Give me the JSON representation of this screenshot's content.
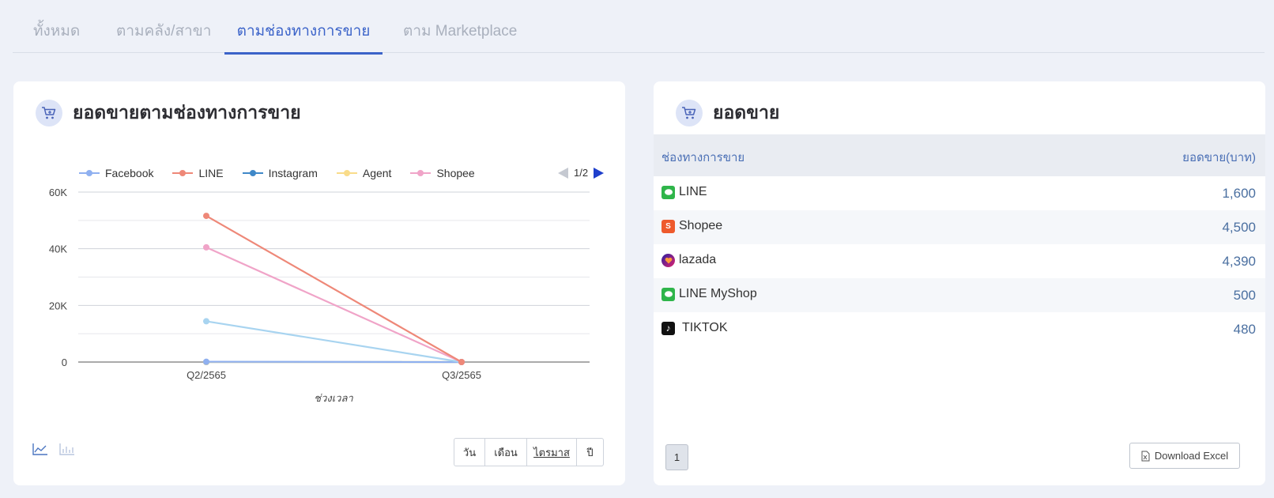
{
  "tabs": [
    {
      "label": "ทั้งหมด",
      "active": false
    },
    {
      "label": "ตามคลัง/สาขา",
      "active": false
    },
    {
      "label": "ตามช่องทางการขาย",
      "active": true
    },
    {
      "label": "ตาม Marketplace",
      "active": false
    }
  ],
  "left_card": {
    "title": "ยอดขายตามช่องทางการขาย",
    "legend_pager": "1/2",
    "period_buttons": [
      "วัน",
      "เดือน",
      "ไตรมาส",
      "ปี"
    ],
    "active_period": "ไตรมาส",
    "icons": [
      "line-chart-icon",
      "bar-chart-icon"
    ]
  },
  "chart_data": {
    "type": "line",
    "categories": [
      "Q2/2565",
      "Q3/2565"
    ],
    "xlabel": "ช่วงเวลา",
    "ylabel": "",
    "ylim": [
      0,
      60000
    ],
    "yticks": [
      "0",
      "20K",
      "40K",
      "60K"
    ],
    "grid": true,
    "legend_placement": "top",
    "series": [
      {
        "name": "Facebook",
        "color": "#8fb0f0",
        "values": [
          100,
          0
        ]
      },
      {
        "name": "LINE",
        "color": "#ee8878",
        "values": [
          51600,
          0
        ]
      },
      {
        "name": "Instagram",
        "color": "#3f88c8",
        "values": [
          0,
          0
        ]
      },
      {
        "name": "Agent",
        "color": "#f9dc8a",
        "values": [
          0,
          0
        ]
      },
      {
        "name": "Shopee",
        "color": "#f0a4c8",
        "values": [
          40500,
          0
        ]
      },
      {
        "color": "#a8d4f0",
        "values": [
          14400,
          0
        ]
      }
    ]
  },
  "right_card": {
    "title": "ยอดขาย",
    "col_channel": "ช่องทางการขาย",
    "col_sales": "ยอดขาย(บาท)",
    "rows": [
      {
        "name": "LINE",
        "value": "1,600",
        "icon": "line-icon"
      },
      {
        "name": "Shopee",
        "value": "4,500",
        "icon": "shopee-icon"
      },
      {
        "name": "lazada",
        "value": "4,390",
        "icon": "lazada-icon"
      },
      {
        "name": "LINE MyShop",
        "value": "500",
        "icon": "line-icon"
      },
      {
        "name": "TIKTOK",
        "value": "480",
        "icon": "tiktok-icon"
      }
    ],
    "page": "1",
    "download_label": "Download Excel"
  }
}
